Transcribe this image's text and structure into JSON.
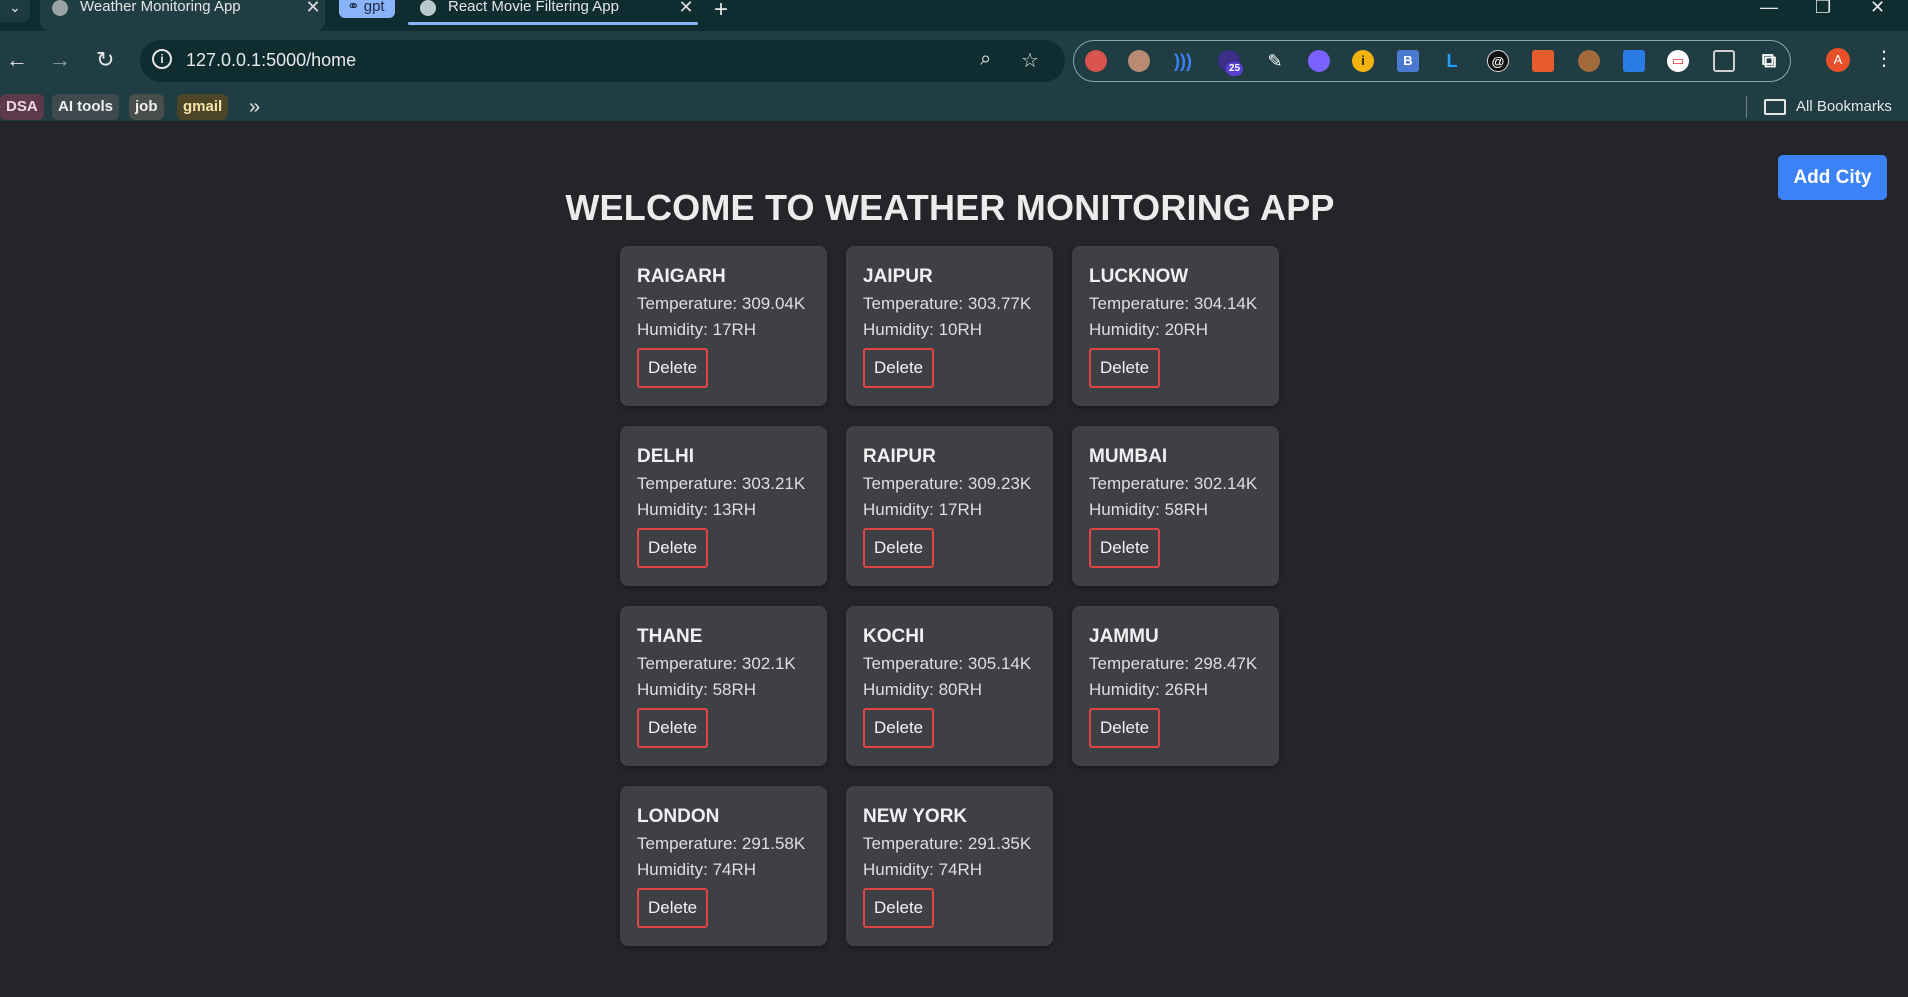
{
  "browser": {
    "tabs": [
      {
        "title": "Weather Monitoring App",
        "active": true
      },
      {
        "title": "React Movie Filtering App",
        "active": false
      }
    ],
    "tab_group": "gpt",
    "url": "127.0.0.1:5000/home",
    "profile_initial": "A",
    "extension_badge": "25",
    "bookmarks": [
      "DSA",
      "AI tools",
      "job",
      "gmail"
    ],
    "all_bookmarks": "All Bookmarks"
  },
  "app": {
    "add_city_label": "Add City",
    "heading": "WELCOME TO WEATHER MONITORING APP",
    "temperature_prefix": "Temperature: ",
    "humidity_prefix": "Humidity: ",
    "delete_label": "Delete",
    "cities": [
      {
        "name": "RAIGARH",
        "temperature": "309.04K",
        "humidity": "17RH"
      },
      {
        "name": "JAIPUR",
        "temperature": "303.77K",
        "humidity": "10RH"
      },
      {
        "name": "LUCKNOW",
        "temperature": "304.14K",
        "humidity": "20RH"
      },
      {
        "name": "DELHI",
        "temperature": "303.21K",
        "humidity": "13RH"
      },
      {
        "name": "RAIPUR",
        "temperature": "309.23K",
        "humidity": "17RH"
      },
      {
        "name": "MUMBAI",
        "temperature": "302.14K",
        "humidity": "58RH"
      },
      {
        "name": "THANE",
        "temperature": "302.1K",
        "humidity": "58RH"
      },
      {
        "name": "KOCHI",
        "temperature": "305.14K",
        "humidity": "80RH"
      },
      {
        "name": "JAMMU",
        "temperature": "298.47K",
        "humidity": "26RH"
      },
      {
        "name": "LONDON",
        "temperature": "291.58K",
        "humidity": "74RH"
      },
      {
        "name": "NEW YORK",
        "temperature": "291.35K",
        "humidity": "74RH"
      }
    ]
  },
  "colors": {
    "page_bg": "#242529",
    "card_bg": "#3f4046",
    "accent_button": "#3b82f6",
    "delete_border": "#e04545"
  }
}
